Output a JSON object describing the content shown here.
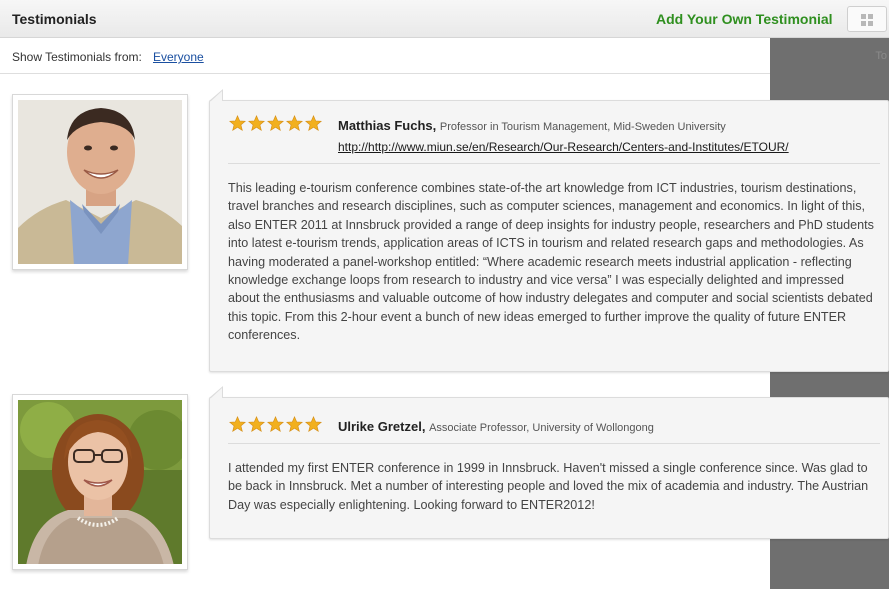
{
  "header": {
    "title": "Testimonials",
    "add_link": "Add Your Own Testimonial"
  },
  "filter": {
    "label": "Show Testimonials from:",
    "value": "Everyone"
  },
  "side_panel": {
    "faded_text": "To"
  },
  "testimonials": [
    {
      "rating": 5,
      "name": "Matthias Fuchs,",
      "role": "Professor in Tourism Management, Mid-Sweden University",
      "url": "http://http://www.miun.se/en/Research/Our-Research/Centers-and-Institutes/ETOUR/",
      "text": "This leading e-tourism conference combines state-of-the art knowledge from ICT industries, tourism destinations, travel branches and research disciplines, such as computer sciences, management and economics. In light of this, also ENTER 2011 at Innsbruck provided a range of deep insights for industry people, researchers and PhD students into latest e-tourism trends, application areas of ICTS in tourism and related research gaps and methodologies. As having moderated a panel-workshop entitled: “Where academic research meets industrial application - reflecting knowledge exchange loops from research to industry and vice versa” I was especially delighted and impressed about the enthusiasms and valuable outcome of how industry delegates and computer and social scientists debated this topic. From this 2-hour event a bunch of new ideas emerged to further improve the quality of future ENTER conferences."
    },
    {
      "rating": 5,
      "name": "Ulrike Gretzel,",
      "role": "Associate Professor, University of Wollongong",
      "url": "",
      "text": "I attended my first ENTER conference in 1999 in Innsbruck. Haven't missed a single conference since. Was glad to be back in Innsbruck. Met a number of interesting people and loved the mix of academia and industry. The Austrian Day was especially enlightening. Looking forward to ENTER2012!"
    }
  ],
  "colors": {
    "accent_green": "#2f8f1f",
    "link_blue": "#1a4fa0",
    "star_gold": "#f2b01e",
    "side_panel": "#6f6f6f"
  }
}
